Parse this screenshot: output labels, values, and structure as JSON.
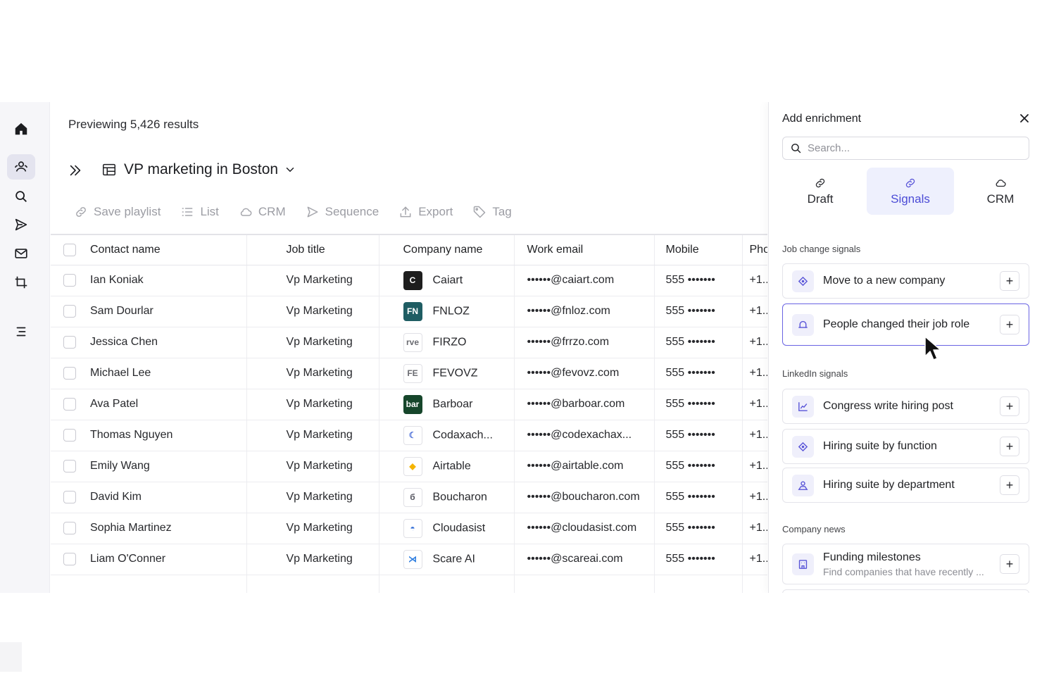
{
  "app": {
    "preview_text": "Previewing 5,426 results",
    "playlist_title": "VP marketing in Boston"
  },
  "rail": {
    "items": [
      {
        "icon": "home-icon"
      },
      {
        "icon": "contacts-icon",
        "active": true
      },
      {
        "icon": "search-icon"
      },
      {
        "icon": "send-icon"
      },
      {
        "icon": "mail-icon"
      },
      {
        "icon": "crop-icon"
      },
      {
        "icon": "menu-icon"
      }
    ]
  },
  "toolbar": {
    "save_playlist": "Save playlist",
    "list": "List",
    "crm": "CRM",
    "sequence": "Sequence",
    "export": "Export",
    "tag": "Tag"
  },
  "table": {
    "headers": {
      "contact": "Contact name",
      "title": "Job title",
      "company": "Company name",
      "email": "Work email",
      "mobile": "Mobile",
      "phone": "Pho"
    },
    "rows": [
      {
        "name": "Ian Koniak",
        "title": "Vp Marketing",
        "company": "Caiart",
        "logo": "C",
        "logo_bg": "#1e1e1e",
        "logo_fg": "#ffffff",
        "email": "••••••@caiart.com",
        "mobile": "555 •••••••",
        "phone": "+1.."
      },
      {
        "name": "Sam Dourlar",
        "title": "Vp Marketing",
        "company": "FNLOZ",
        "logo": "FN",
        "logo_bg": "#1f5d63",
        "logo_fg": "#ffffff",
        "email": "••••••@fnloz.com",
        "mobile": "555 •••••••",
        "phone": "+1.."
      },
      {
        "name": "Jessica Chen",
        "title": "Vp Marketing",
        "company": "FIRZO",
        "logo": "rve",
        "logo_bg": "#ffffff",
        "logo_fg": "#6b6c72",
        "email": "••••••@frrzo.com",
        "mobile": "555 •••••••",
        "phone": "+1.."
      },
      {
        "name": "Michael Lee",
        "title": "Vp Marketing",
        "company": "FEVOVZ",
        "logo": "FE",
        "logo_bg": "#ffffff",
        "logo_fg": "#6b6c72",
        "email": "••••••@fevovz.com",
        "mobile": "555 •••••••",
        "phone": "+1.."
      },
      {
        "name": "Ava Patel",
        "title": "Vp Marketing",
        "company": "Barboar",
        "logo": "bar",
        "logo_bg": "#16462b",
        "logo_fg": "#ffffff",
        "email": "••••••@barboar.com",
        "mobile": "555 •••••••",
        "phone": "+1.."
      },
      {
        "name": "Thomas Nguyen",
        "title": "Vp Marketing",
        "company": "Codaxach...",
        "logo": "☾",
        "logo_bg": "#ffffff",
        "logo_fg": "#4c6fd8",
        "email": "••••••@codexachax...",
        "mobile": "555 •••••••",
        "phone": "+1.."
      },
      {
        "name": "Emily Wang",
        "title": "Vp Marketing",
        "company": "Airtable",
        "logo": "◆",
        "logo_bg": "#ffffff",
        "logo_fg": "#f5b400",
        "email": "••••••@airtable.com",
        "mobile": "555 •••••••",
        "phone": "+1.."
      },
      {
        "name": "David Kim",
        "title": "Vp Marketing",
        "company": "Boucharon",
        "logo": "б",
        "logo_bg": "#ffffff",
        "logo_fg": "#555660",
        "email": "••••••@boucharon.com",
        "mobile": "555 •••••••",
        "phone": "+1.."
      },
      {
        "name": "Sophia Martinez",
        "title": "Vp Marketing",
        "company": "Cloudasist",
        "logo": "◓",
        "logo_bg": "#ffffff",
        "logo_fg": "#3a73d8",
        "email": "••••••@cloudasist.com",
        "mobile": "555 •••••••",
        "phone": "+1.."
      },
      {
        "name": "Liam O'Conner",
        "title": "Vp Marketing",
        "company": "Scare AI",
        "logo": "⋊",
        "logo_bg": "#ffffff",
        "logo_fg": "#2f7ee0",
        "email": "••••••@scareai.com",
        "mobile": "555 •••••••",
        "phone": "+1.."
      }
    ]
  },
  "panel": {
    "title": "Add enrichment",
    "search_placeholder": "Search...",
    "tabs": [
      {
        "label": "Draft"
      },
      {
        "label": "Signals",
        "active": true
      },
      {
        "label": "CRM"
      }
    ],
    "sections": {
      "job_change": "Job change signals",
      "linkedin": "LinkedIn signals",
      "company_news": "Company news"
    },
    "items": {
      "move_company": "Move to a new company",
      "changed_role": "People changed their job role",
      "hiring_post": "Congress write hiring post",
      "hiring_function": "Hiring suite by function",
      "hiring_department": "Hiring suite by department",
      "funding": "Funding milestones",
      "funding_sub": "Find companies that have recently ..."
    }
  },
  "colors": {
    "accent": "#5a56d8",
    "accent_bg": "#eef0fd",
    "rail_bg": "#f6f6f9"
  }
}
